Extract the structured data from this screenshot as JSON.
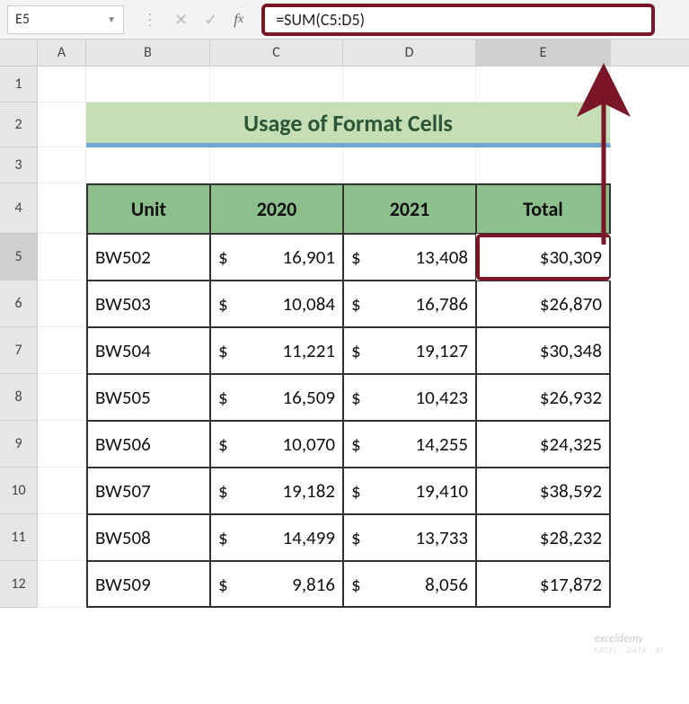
{
  "formula_bar": {
    "name_box": "E5",
    "formula": "=SUM(C5:D5)"
  },
  "columns": {
    "A": "A",
    "B": "B",
    "C": "C",
    "D": "D",
    "E": "E"
  },
  "row_numbers": [
    "1",
    "2",
    "3",
    "4",
    "5",
    "6",
    "7",
    "8",
    "9",
    "10",
    "11",
    "12"
  ],
  "banner": "Usage of Format Cells",
  "headers": {
    "unit": "Unit",
    "y2020": "2020",
    "y2021": "2021",
    "total": "Total"
  },
  "rows": [
    {
      "unit": "BW502",
      "y2020": "16,901",
      "y2021": "13,408",
      "total": "$30,309"
    },
    {
      "unit": "BW503",
      "y2020": "10,084",
      "y2021": "16,786",
      "total": "$26,870"
    },
    {
      "unit": "BW504",
      "y2020": "11,221",
      "y2021": "19,127",
      "total": "$30,348"
    },
    {
      "unit": "BW505",
      "y2020": "16,509",
      "y2021": "10,423",
      "total": "$26,932"
    },
    {
      "unit": "BW506",
      "y2020": "10,070",
      "y2021": "14,255",
      "total": "$24,325"
    },
    {
      "unit": "BW507",
      "y2020": "19,182",
      "y2021": "19,410",
      "total": "$38,592"
    },
    {
      "unit": "BW508",
      "y2020": "14,499",
      "y2021": "13,733",
      "total": "$28,232"
    },
    {
      "unit": "BW509",
      "y2020": "9,816",
      "y2021": "8,056",
      "total": "$17,872"
    }
  ],
  "currency": "$",
  "watermark": {
    "main": "exceldemy",
    "sub": "EXCEL · DATA · BI"
  },
  "selected_cell": "E5",
  "chart_data": {
    "type": "table",
    "title": "Usage of Format Cells",
    "columns": [
      "Unit",
      "2020",
      "2021",
      "Total"
    ],
    "rows": [
      [
        "BW502",
        16901,
        13408,
        30309
      ],
      [
        "BW503",
        10084,
        16786,
        26870
      ],
      [
        "BW504",
        11221,
        19127,
        30348
      ],
      [
        "BW505",
        16509,
        10423,
        26932
      ],
      [
        "BW506",
        10070,
        14255,
        24325
      ],
      [
        "BW507",
        19182,
        19410,
        38592
      ],
      [
        "BW508",
        14499,
        13733,
        28232
      ],
      [
        "BW509",
        9816,
        8056,
        17872
      ]
    ]
  }
}
